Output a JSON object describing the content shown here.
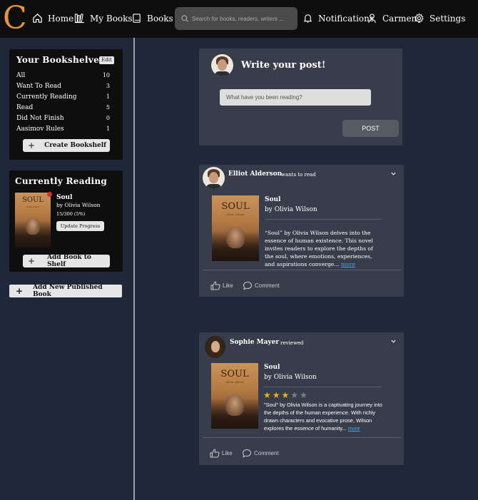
{
  "brand": {
    "logo_letter": "C",
    "accent": "#e6953d"
  },
  "nav": {
    "home": "Home",
    "my_books": "My Books",
    "books": "Books",
    "search_placeholder": "Search for books, readers, writers ...",
    "notifications": "Notifications",
    "user": "Carmen",
    "settings": "Settings"
  },
  "bookshelves": {
    "title": "Your Bookshelves",
    "edit_label": "Edit",
    "items": [
      {
        "label": "All",
        "count": "10"
      },
      {
        "label": "Want To Read",
        "count": "3"
      },
      {
        "label": "Currently Reading",
        "count": "1"
      },
      {
        "label": "Read",
        "count": "5"
      },
      {
        "label": "Did Not Finish",
        "count": "0"
      },
      {
        "label": "Aasimov Rules",
        "count": "1"
      }
    ],
    "create_label": "Create Bookshelf"
  },
  "currently_reading": {
    "title": "Currently Reading",
    "book_title": "Soul",
    "book_author": "by Olivia Wilson",
    "progress": "15/300 (5%)",
    "update_label": "Update Progress",
    "add_label": "Add Book to Shelf"
  },
  "add_published_label": "Add New Published Book",
  "composer": {
    "title": "Write your post!",
    "placeholder": "What have you been reading?",
    "post_label": "POST"
  },
  "cover": {
    "title": "SOUL",
    "subtitle": "olivia wilson"
  },
  "feed": [
    {
      "author": "Elliot Alderson",
      "action": "wants to read",
      "book_title": "Soul",
      "book_author": "by Olivia Wilson",
      "description": "“Soul” by Olivia Wilson delves into the essence of human existence. This novel invites readers to explore the depths of the soul, where emotions, experiences, and aspirations converge...",
      "more": "more",
      "like": "Like",
      "comment": "Comment"
    },
    {
      "author": "Sophie Mayer",
      "action": "reviewed",
      "book_title": "Soul",
      "book_author": "by Olivia Wilson",
      "rating": 3,
      "rating_max": 5,
      "description": "\"Soul\" by Olivia Wilson is a captivating journey into the depths of the human experience. With richly drawn characters and evocative prose, Wilson explores the essence of humanity...",
      "more": "more",
      "like": "Like",
      "comment": "Comment"
    }
  ],
  "colors": {
    "star_on": "#e8b020",
    "star_off": "#7a7f88",
    "link": "#4aa3e0"
  }
}
